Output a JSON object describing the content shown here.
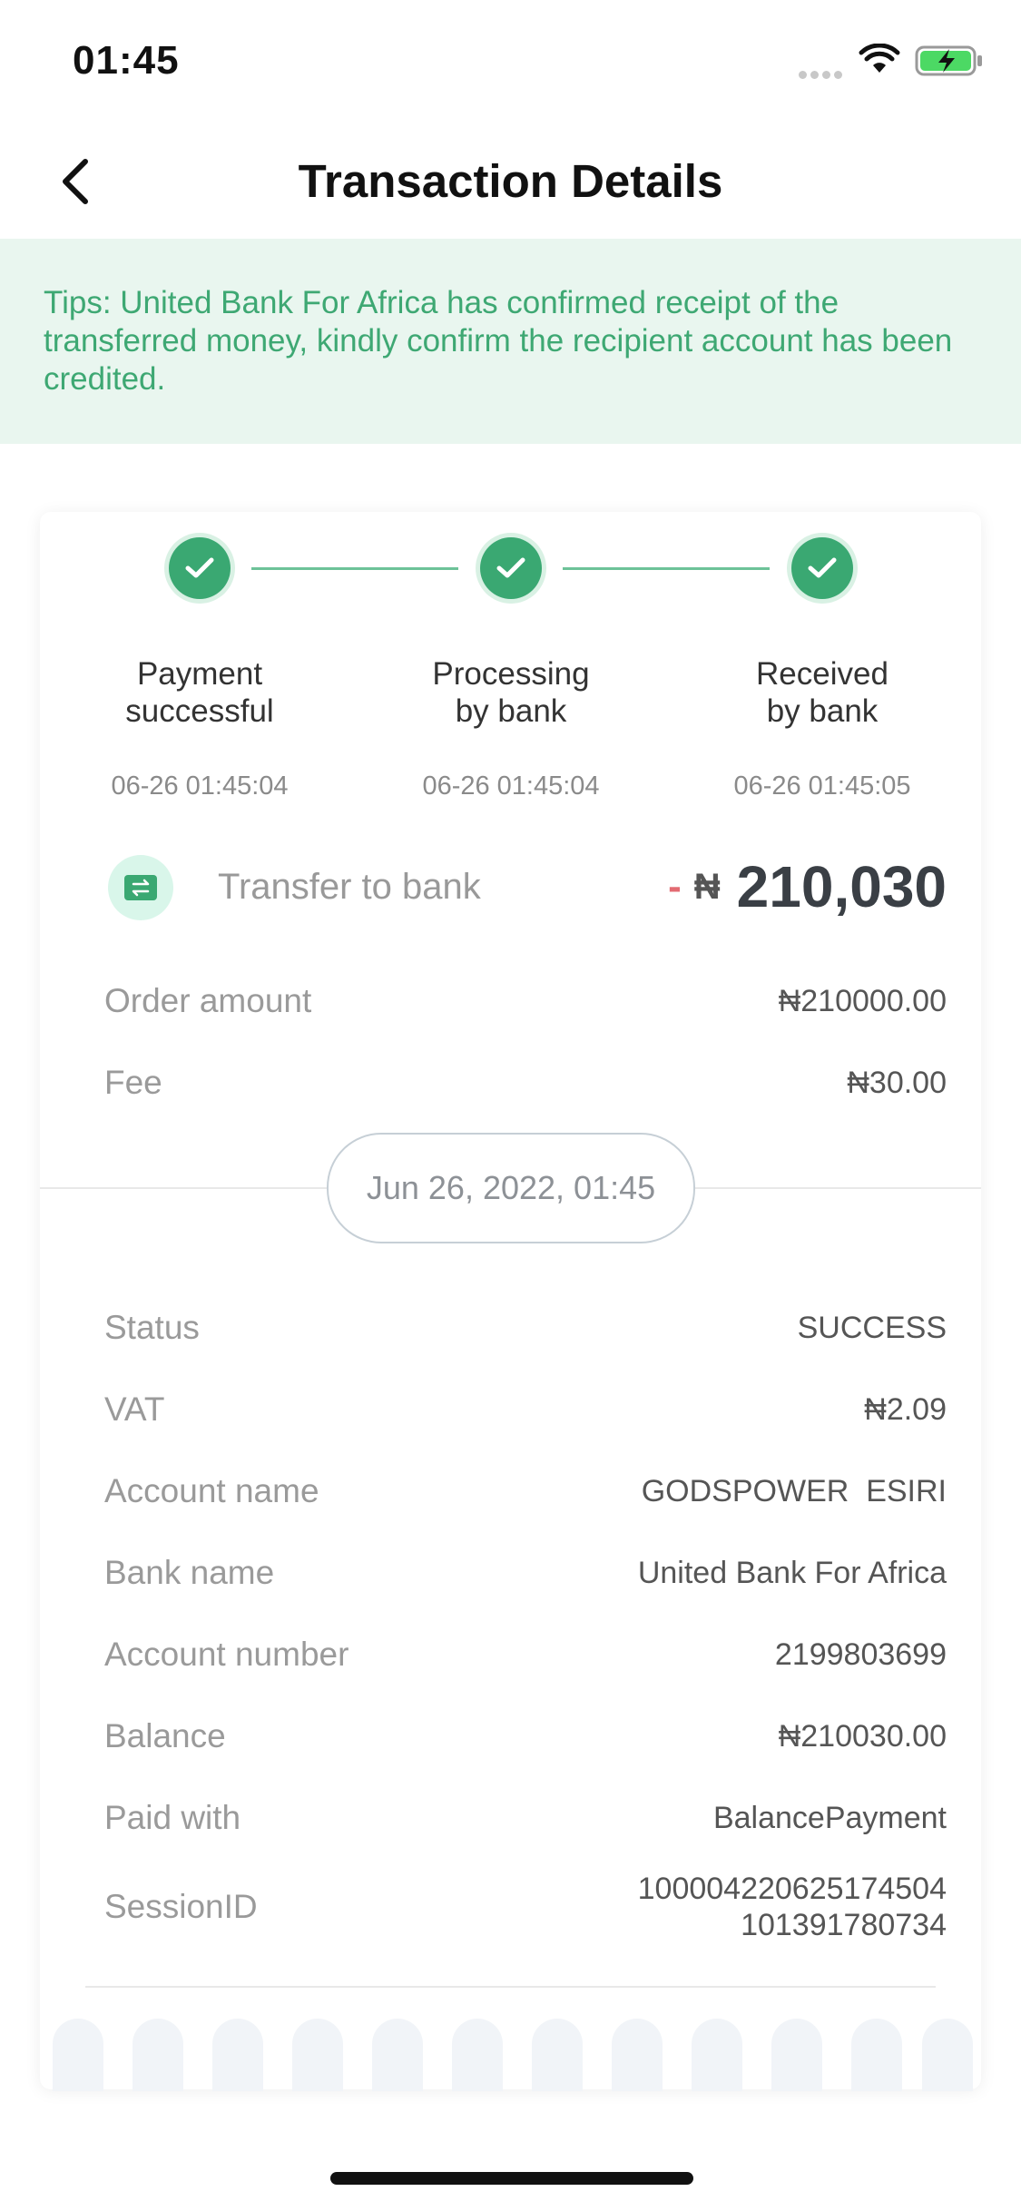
{
  "status_bar": {
    "time": "01:45"
  },
  "header": {
    "title": "Transaction Details"
  },
  "tips": {
    "text": "Tips: United Bank For Africa has confirmed receipt of the transferred money, kindly confirm the recipient account has been credited."
  },
  "steps": [
    {
      "line1": "Payment",
      "line2": "successful",
      "time": "06-26 01:45:04"
    },
    {
      "line1": "Processing",
      "line2": "by bank",
      "time": "06-26 01:45:04"
    },
    {
      "line1": "Received",
      "line2": "by bank",
      "time": "06-26 01:45:05"
    }
  ],
  "transfer": {
    "label": "Transfer to bank",
    "sign": "-",
    "currency": "₦",
    "amount": "210,030"
  },
  "summary": [
    {
      "label": "Order amount",
      "value": "₦210000.00"
    },
    {
      "label": "Fee",
      "value": "₦30.00"
    }
  ],
  "date": "Jun 26, 2022, 01:45",
  "details": [
    {
      "label": "Status",
      "value": "SUCCESS"
    },
    {
      "label": "VAT",
      "value": "₦2.09"
    },
    {
      "label": "Account name",
      "value": "GODSPOWER  ESIRI"
    },
    {
      "label": "Bank name",
      "value": "United Bank For Africa"
    },
    {
      "label": "Account number",
      "value": "2199803699"
    },
    {
      "label": "Balance",
      "value": "₦210030.00"
    },
    {
      "label": "Paid with",
      "value": "BalancePayment"
    },
    {
      "label": "SessionID",
      "value_line1": "100004220625174504",
      "value_line2": "101391780734"
    }
  ],
  "colors": {
    "accent_green": "#3aa872",
    "tips_bg": "#e9f6ef",
    "tips_text": "#3ea873",
    "minus_red": "#e36b72"
  }
}
